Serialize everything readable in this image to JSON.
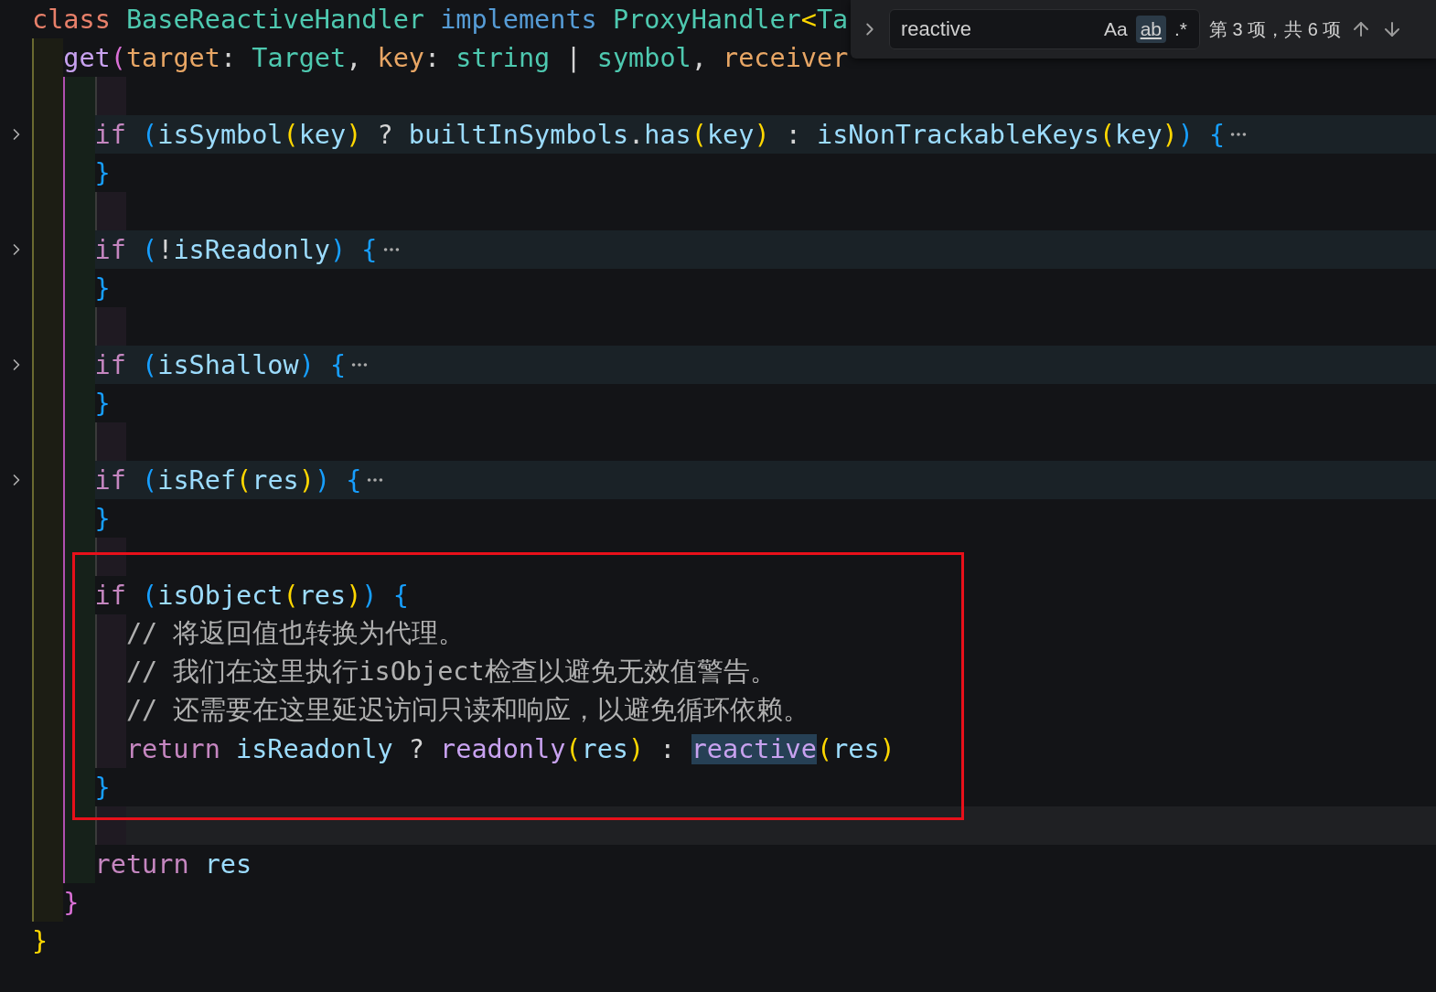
{
  "find_widget": {
    "value": "reactive",
    "toggles": [
      {
        "label": "Aa",
        "selected": false
      },
      {
        "label": "ab",
        "selected": true
      },
      {
        "label": ".*",
        "selected": false
      }
    ],
    "result": "第 3 项，共 6 项"
  },
  "lines": [
    {
      "folded": false,
      "current": false,
      "tokens": [
        {
          "kind": "storage",
          "text": "class "
        },
        {
          "kind": "type",
          "text": "BaseReactiveHandler "
        },
        {
          "kind": "impl",
          "text": "implements "
        },
        {
          "kind": "type",
          "text": "ProxyHandler"
        },
        {
          "kind": "b1",
          "text": "<"
        },
        {
          "kind": "type",
          "text": "Ta"
        }
      ],
      "children": [
        {
          "folded": false,
          "current": false,
          "tokens": [
            {
              "kind": "fn",
              "text": "get"
            },
            {
              "kind": "b2",
              "text": "("
            },
            {
              "kind": "param",
              "text": "target"
            },
            {
              "kind": "op",
              "text": ": "
            },
            {
              "kind": "type",
              "text": "Target"
            },
            {
              "kind": "op",
              "text": ", "
            },
            {
              "kind": "param",
              "text": "key"
            },
            {
              "kind": "op",
              "text": ": "
            },
            {
              "kind": "type",
              "text": "string "
            },
            {
              "kind": "op",
              "text": "| "
            },
            {
              "kind": "type",
              "text": "symbol"
            },
            {
              "kind": "op",
              "text": ", "
            },
            {
              "kind": "param",
              "text": "receiver"
            }
          ],
          "children": [
            {
              "folded": false,
              "current": false
            },
            {
              "folded": true,
              "current": false,
              "tokens": [
                {
                  "kind": "kw",
                  "text": "if "
                },
                {
                  "kind": "b3",
                  "text": "("
                },
                {
                  "kind": "var",
                  "text": "isSymbol"
                },
                {
                  "kind": "b1",
                  "text": "("
                },
                {
                  "kind": "var",
                  "text": "key"
                },
                {
                  "kind": "b1",
                  "text": ")"
                },
                {
                  "kind": "op",
                  "text": " ? "
                },
                {
                  "kind": "var",
                  "text": "builtInSymbols"
                },
                {
                  "kind": "op",
                  "text": "."
                },
                {
                  "kind": "var",
                  "text": "has"
                },
                {
                  "kind": "b1",
                  "text": "("
                },
                {
                  "kind": "var",
                  "text": "key"
                },
                {
                  "kind": "b1",
                  "text": ")"
                },
                {
                  "kind": "op",
                  "text": " : "
                },
                {
                  "kind": "var",
                  "text": "isNonTrackableKeys"
                },
                {
                  "kind": "b1",
                  "text": "("
                },
                {
                  "kind": "var",
                  "text": "key"
                },
                {
                  "kind": "b1",
                  "text": ")"
                },
                {
                  "kind": "b3",
                  "text": ")"
                },
                {
                  "kind": "b3",
                  "text": " {"
                }
              ]
            },
            {
              "folded": false,
              "current": false,
              "tokens": [
                {
                  "kind": "b3",
                  "text": "}"
                }
              ]
            },
            {
              "folded": false,
              "current": false
            },
            {
              "folded": true,
              "current": false,
              "tokens": [
                {
                  "kind": "kw",
                  "text": "if "
                },
                {
                  "kind": "b3",
                  "text": "("
                },
                {
                  "kind": "op",
                  "text": "!"
                },
                {
                  "kind": "var",
                  "text": "isReadonly"
                },
                {
                  "kind": "b3",
                  "text": ")"
                },
                {
                  "kind": "b3",
                  "text": " {"
                }
              ]
            },
            {
              "folded": false,
              "current": false,
              "tokens": [
                {
                  "kind": "b3",
                  "text": "}"
                }
              ]
            },
            {
              "folded": false,
              "current": false
            },
            {
              "folded": true,
              "current": false,
              "tokens": [
                {
                  "kind": "kw",
                  "text": "if "
                },
                {
                  "kind": "b3",
                  "text": "("
                },
                {
                  "kind": "var",
                  "text": "isShallow"
                },
                {
                  "kind": "b3",
                  "text": ")"
                },
                {
                  "kind": "b3",
                  "text": " {"
                }
              ]
            },
            {
              "folded": false,
              "current": false,
              "tokens": [
                {
                  "kind": "b3",
                  "text": "}"
                }
              ]
            },
            {
              "folded": false,
              "current": false
            },
            {
              "folded": true,
              "current": false,
              "tokens": [
                {
                  "kind": "kw",
                  "text": "if "
                },
                {
                  "kind": "b3",
                  "text": "("
                },
                {
                  "kind": "var",
                  "text": "isRef"
                },
                {
                  "kind": "b1",
                  "text": "("
                },
                {
                  "kind": "var",
                  "text": "res"
                },
                {
                  "kind": "b1",
                  "text": ")"
                },
                {
                  "kind": "b3",
                  "text": ")"
                },
                {
                  "kind": "b3",
                  "text": " {"
                }
              ]
            },
            {
              "folded": false,
              "current": false,
              "tokens": [
                {
                  "kind": "b3",
                  "text": "}"
                }
              ]
            },
            {
              "folded": false,
              "current": false
            },
            {
              "folded": false,
              "current": false,
              "tokens": [
                {
                  "kind": "kw",
                  "text": "if "
                },
                {
                  "kind": "b3",
                  "text": "("
                },
                {
                  "kind": "var",
                  "text": "isObject"
                },
                {
                  "kind": "b1",
                  "text": "("
                },
                {
                  "kind": "var",
                  "text": "res"
                },
                {
                  "kind": "b1",
                  "text": ")"
                },
                {
                  "kind": "b3",
                  "text": ")"
                },
                {
                  "kind": "b3",
                  "text": " {"
                }
              ],
              "children": [
                {
                  "folded": false,
                  "current": false,
                  "tokens": [
                    {
                      "kind": "comment",
                      "text": "// 将返回值也转换为代理。"
                    }
                  ]
                },
                {
                  "folded": false,
                  "current": false,
                  "tokens": [
                    {
                      "kind": "comment",
                      "text": "// 我们在这里执行isObject检查以避免无效值警告。"
                    }
                  ]
                },
                {
                  "folded": false,
                  "current": false,
                  "tokens": [
                    {
                      "kind": "comment",
                      "text": "// 还需要在这里延迟访问只读和响应，以避免循环依赖。"
                    }
                  ]
                },
                {
                  "folded": false,
                  "current": false,
                  "tokens": [
                    {
                      "kind": "kw",
                      "text": "return "
                    },
                    {
                      "kind": "var",
                      "text": "isReadonly"
                    },
                    {
                      "kind": "op",
                      "text": " ? "
                    },
                    {
                      "kind": "fn",
                      "text": "readonly"
                    },
                    {
                      "kind": "b1",
                      "text": "("
                    },
                    {
                      "kind": "var",
                      "text": "res"
                    },
                    {
                      "kind": "b1",
                      "text": ")"
                    },
                    {
                      "kind": "op",
                      "text": " : "
                    },
                    {
                      "kind": "match",
                      "text": "reactive"
                    },
                    {
                      "kind": "b1",
                      "text": "("
                    },
                    {
                      "kind": "var",
                      "text": "res"
                    },
                    {
                      "kind": "b1",
                      "text": ")"
                    }
                  ]
                }
              ]
            },
            {
              "folded": false,
              "current": false,
              "tokens": [
                {
                  "kind": "b3",
                  "text": "}"
                }
              ]
            },
            {
              "folded": false,
              "current": true
            },
            {
              "folded": false,
              "current": false,
              "tokens": [
                {
                  "kind": "kw",
                  "text": "return "
                },
                {
                  "kind": "var",
                  "text": "res"
                }
              ]
            }
          ]
        },
        {
          "folded": false,
          "current": false,
          "tokens": [
            {
              "kind": "b2",
              "text": "}"
            }
          ]
        }
      ]
    },
    {
      "folded": false,
      "current": false,
      "tokens": [
        {
          "kind": "b1",
          "text": "}"
        }
      ]
    }
  ]
}
